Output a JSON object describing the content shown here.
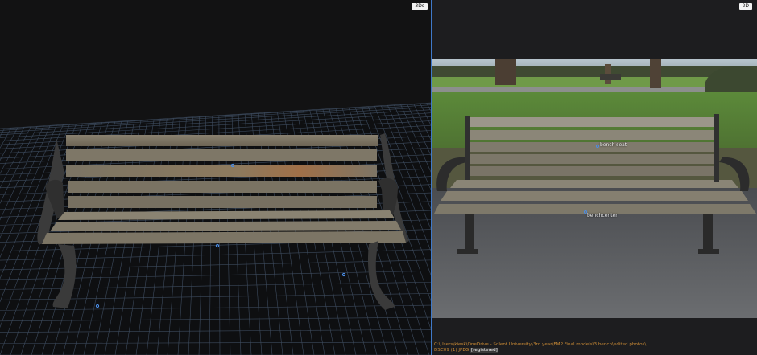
{
  "viewport3d": {
    "badge": "3Ds"
  },
  "viewport2d": {
    "badge": "2D",
    "pins": [
      {
        "label": "bench seat"
      },
      {
        "label": "benchcenter"
      }
    ]
  },
  "status": {
    "path": "C:\\Users\\kiesk\\OneDrive - Solent University\\3rd year\\FMP Final models\\3 bench\\edited photos\\",
    "file": "DSC09 (1) JPEG",
    "state": "[registered]"
  },
  "colors": {
    "divider": "#3f79c9",
    "grid": "#3d4b5e",
    "path_text": "#c98a35",
    "point_marker": "#4a8de6"
  }
}
